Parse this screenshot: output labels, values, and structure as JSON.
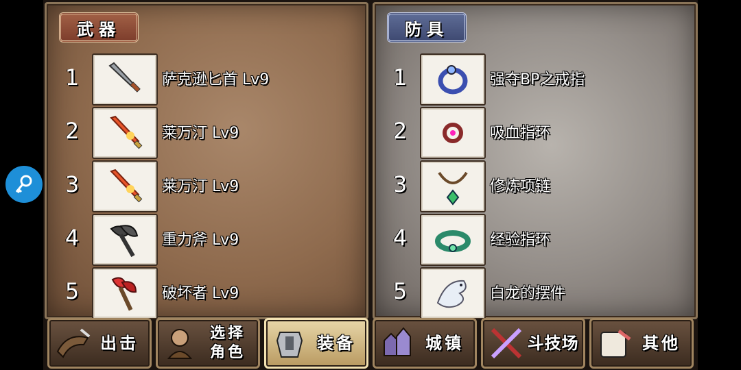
{
  "weapons": {
    "title": "武器",
    "items": [
      {
        "num": "1",
        "name": "萨克逊匕首 Lv9",
        "icon": "dagger-icon"
      },
      {
        "num": "2",
        "name": "莱万汀 Lv9",
        "icon": "flame-sword-icon"
      },
      {
        "num": "3",
        "name": "莱万汀 Lv9",
        "icon": "flame-sword-icon"
      },
      {
        "num": "4",
        "name": "重力斧 Lv9",
        "icon": "axe-icon"
      },
      {
        "num": "5",
        "name": "破坏者 Lv9",
        "icon": "red-axe-icon"
      }
    ]
  },
  "armor": {
    "title": "防具",
    "items": [
      {
        "num": "1",
        "name": "强夺BP之戒指",
        "icon": "blue-ring-icon"
      },
      {
        "num": "2",
        "name": "吸血指环",
        "icon": "red-ring-icon"
      },
      {
        "num": "3",
        "name": "修炼项链",
        "icon": "necklace-icon"
      },
      {
        "num": "4",
        "name": "经验指环",
        "icon": "green-ring-icon"
      },
      {
        "num": "5",
        "name": "白龙的摆件",
        "icon": "white-dragon-icon"
      }
    ]
  },
  "tabs": [
    {
      "label": "出击",
      "icon": "sortie-icon",
      "active": false
    },
    {
      "label": "选择\n角色",
      "icon": "character-icon",
      "active": false
    },
    {
      "label": "装备",
      "icon": "equipment-icon",
      "active": true
    },
    {
      "label": "城镇",
      "icon": "town-icon",
      "active": false
    },
    {
      "label": "斗技场",
      "icon": "arena-icon",
      "active": false
    },
    {
      "label": "其他",
      "icon": "other-icon",
      "active": false
    }
  ],
  "colors": {
    "weapon_panel": "#8e6a4d",
    "armor_panel": "#958f8a",
    "weapon_title": "#7e3e2c",
    "armor_title": "#3f4a72",
    "overlay_button": "#1e8fd8"
  }
}
